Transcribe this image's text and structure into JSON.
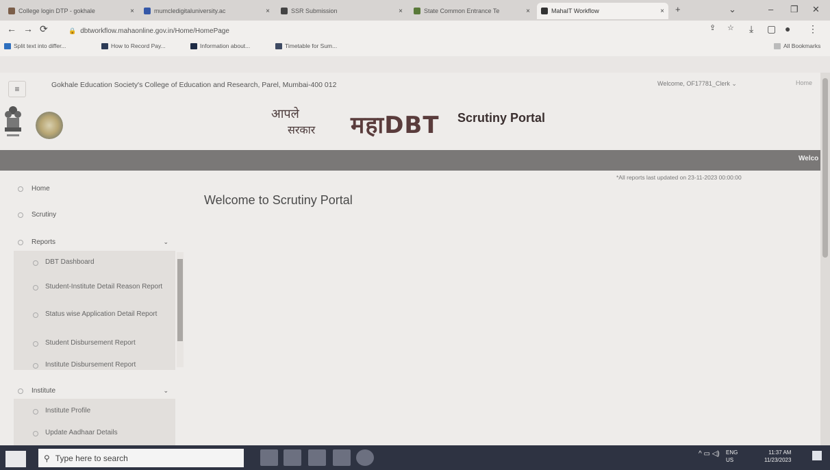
{
  "browser": {
    "tabs": [
      {
        "label": "College login DTP - gokhale",
        "color": "#7b5e49"
      },
      {
        "label": "mumcledigitaluniversity.ac",
        "color": "#3558a8"
      },
      {
        "label": "SSR Submission",
        "color": "#444444"
      },
      {
        "label": "State Common Entrance Te",
        "color": "#5a7a3a"
      },
      {
        "label": "MahaIT Workflow",
        "color": "#333333"
      }
    ],
    "new_tab": "+",
    "url": "dbtworkflow.mahaonline.gov.in/Home/HomePage",
    "bookmarks": [
      "Split text into differ...",
      "How to Record Pay...",
      "Information about...",
      "Timetable for Sum..."
    ],
    "all_bookmarks": "All Bookmarks"
  },
  "header": {
    "college": "Gokhale Education Society's College of Education and Research, Parel, Mumbai-400 012",
    "welcome": "Welcome, OF17781_Clerk",
    "home": "Home",
    "aple_line1": "आपले",
    "aple_line2": "सरकार",
    "brand": "महाDBT",
    "portal_title": "Scrutiny Portal",
    "welcome_band": "Welco"
  },
  "sidebar": {
    "items": [
      "Home",
      "Scrutiny",
      "Reports"
    ],
    "reports_sub": [
      "DBT Dashboard",
      "Student-Institute Detail Reason Report",
      "Status wise Application Detail Report",
      "Student Disbursement Report",
      "Institute Disbursement Report"
    ],
    "institute": "Institute",
    "institute_sub": [
      "Institute Profile",
      "Update Aadhaar Details"
    ]
  },
  "main": {
    "title": "Welcome to Scrutiny Portal",
    "updated": "*All reports last updated on 23-11-2023 00:00:00"
  },
  "taskbar": {
    "search_placeholder": "Type here to search",
    "lang1": "ENG",
    "lang2": "US",
    "time": "11:37 AM",
    "date": "11/23/2023"
  },
  "colors": {
    "band": "#7a7877",
    "taskbar": "#2e3342",
    "brand": "#5a3c3c"
  }
}
